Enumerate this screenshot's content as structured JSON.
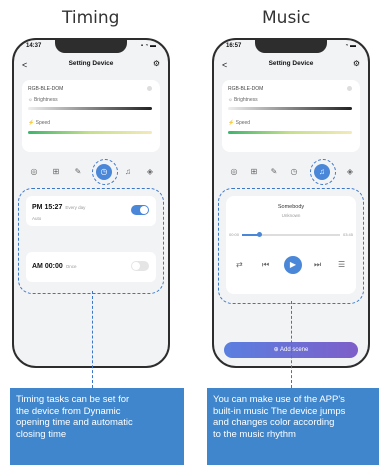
{
  "titles": {
    "left": "Timing",
    "right": "Music"
  },
  "left_phone": {
    "status_time": "14:37",
    "status_icons": "▪ ◔ ▬",
    "header": {
      "back": "<",
      "title": "Setting Device",
      "settings": "⚙"
    },
    "device_name": "RGB-BLE-DOM",
    "brightness_label": "☼ Brightness",
    "speed_label": "⚡ Speed",
    "mode_icons": [
      "palette-icon",
      "grid-icon",
      "brush-icon",
      "clock-icon",
      "music-icon",
      "sound-icon"
    ],
    "tasks": [
      {
        "time": "PM 15:27",
        "repeat": "Every day",
        "sub": "Auto",
        "enabled": true
      },
      {
        "time": "AM 00:00",
        "repeat": "Once",
        "sub": "",
        "enabled": false
      }
    ]
  },
  "right_phone": {
    "status_time": "16:57",
    "status_icons": "◔ ▬",
    "header": {
      "back": "<",
      "title": "Setting Device",
      "settings": "⚙"
    },
    "device_name": "RGB-BLE-DOM",
    "brightness_label": "☼ Brightness",
    "speed_label": "⚡ Speed",
    "mode_icons": [
      "palette-icon",
      "grid-icon",
      "brush-icon",
      "clock-icon",
      "music-icon",
      "sound-icon"
    ],
    "song": "Somebody",
    "artist": "Unknown",
    "time_start": "00:00",
    "time_end": "03:45",
    "progress": 0.18,
    "controls": {
      "repeat": "⇄",
      "prev": "⏮",
      "play": "▶",
      "next": "⏭",
      "list": "☰"
    },
    "add_scene": "⊕ Add scene"
  },
  "captions": {
    "left": [
      "Timing tasks can be set for",
      "the device from Dynamic",
      "opening time and automatic",
      "closing time"
    ],
    "right": [
      "You can make use of the APP's",
      "built-in music The device jumps",
      "and changes color according",
      "to the music rhythm"
    ]
  },
  "colors": {
    "accent": "#4a87d8",
    "dash": "#3a76c9",
    "caption_bg": "#3f86cd"
  }
}
